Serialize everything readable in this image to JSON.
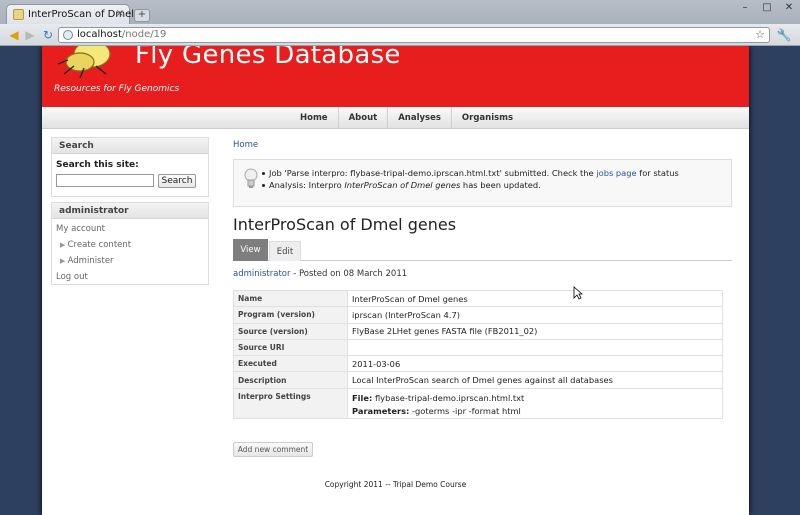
{
  "browser": {
    "tab_title": "InterProScan of Dmel",
    "tab_close": "×",
    "new_tab": "+",
    "url_host": "localhost",
    "url_path": "/node/19"
  },
  "site": {
    "name": "Fly Genes Database",
    "slogan": "Resources for Fly Genomics",
    "nav": [
      "Home",
      "About",
      "Analyses",
      "Organisms"
    ]
  },
  "sidebar": {
    "search": {
      "title": "Search",
      "label": "Search this site:",
      "input_value": "",
      "button": "Search"
    },
    "admin": {
      "title": "administrator",
      "items": [
        {
          "label": "My account"
        },
        {
          "label": "Create content"
        },
        {
          "label": "Administer"
        },
        {
          "label": "Log out"
        }
      ]
    }
  },
  "main": {
    "breadcrumb": "Home",
    "messages": [
      {
        "pre": "Job 'Parse interpro: flybase-tripal-demo.iprscan.html.txt' submitted. Check the ",
        "link": "jobs page",
        "post": " for status"
      },
      {
        "pre": "Analysis: Interpro ",
        "em": "InterProScan of Dmel genes",
        "post": " has been updated."
      }
    ],
    "title": "InterProScan of Dmel genes",
    "tabs": {
      "view": "View",
      "edit": "Edit"
    },
    "submitted": {
      "author": "administrator",
      "text": " - Posted on 08 March 2011"
    },
    "details": [
      {
        "key": "Name",
        "value": "InterProScan of Dmel genes"
      },
      {
        "key": "Program (version)",
        "value": "iprscan (InterProScan 4.7)"
      },
      {
        "key": "Source (version)",
        "value": "FlyBase 2LHet genes FASTA file (FB2011_02)"
      },
      {
        "key": "Source URI",
        "value": ""
      },
      {
        "key": "Executed",
        "value": "2011-03-06"
      },
      {
        "key": "Description",
        "value": "Local InterProScan search of Dmel genes against all databases"
      }
    ],
    "settings": {
      "key": "Interpro Settings",
      "file_label": "File:",
      "file_value": " flybase-tripal-demo.iprscan.html.txt",
      "params_label": "Parameters:",
      "params_value": " -goterms -ipr -format html"
    },
    "add_comment": "Add new comment"
  },
  "footer": "Copyright 2011 -- Tripal Demo Course"
}
